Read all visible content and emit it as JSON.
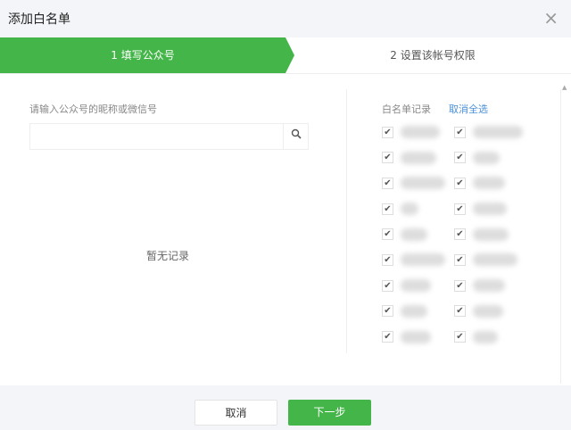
{
  "dialog": {
    "title": "添加白名单",
    "close_icon": "×"
  },
  "steps": [
    {
      "label": "1 填写公众号"
    },
    {
      "label": "2 设置该帐号权限"
    }
  ],
  "left": {
    "label": "请输入公众号的昵称或微信号",
    "search_value": "",
    "search_icon": "🔍",
    "empty_text": "暂无记录"
  },
  "right": {
    "label": "白名单记录",
    "deselect_all": "取消全选",
    "checkmark": "✔"
  },
  "footer": {
    "cancel": "取消",
    "next": "下一步"
  }
}
